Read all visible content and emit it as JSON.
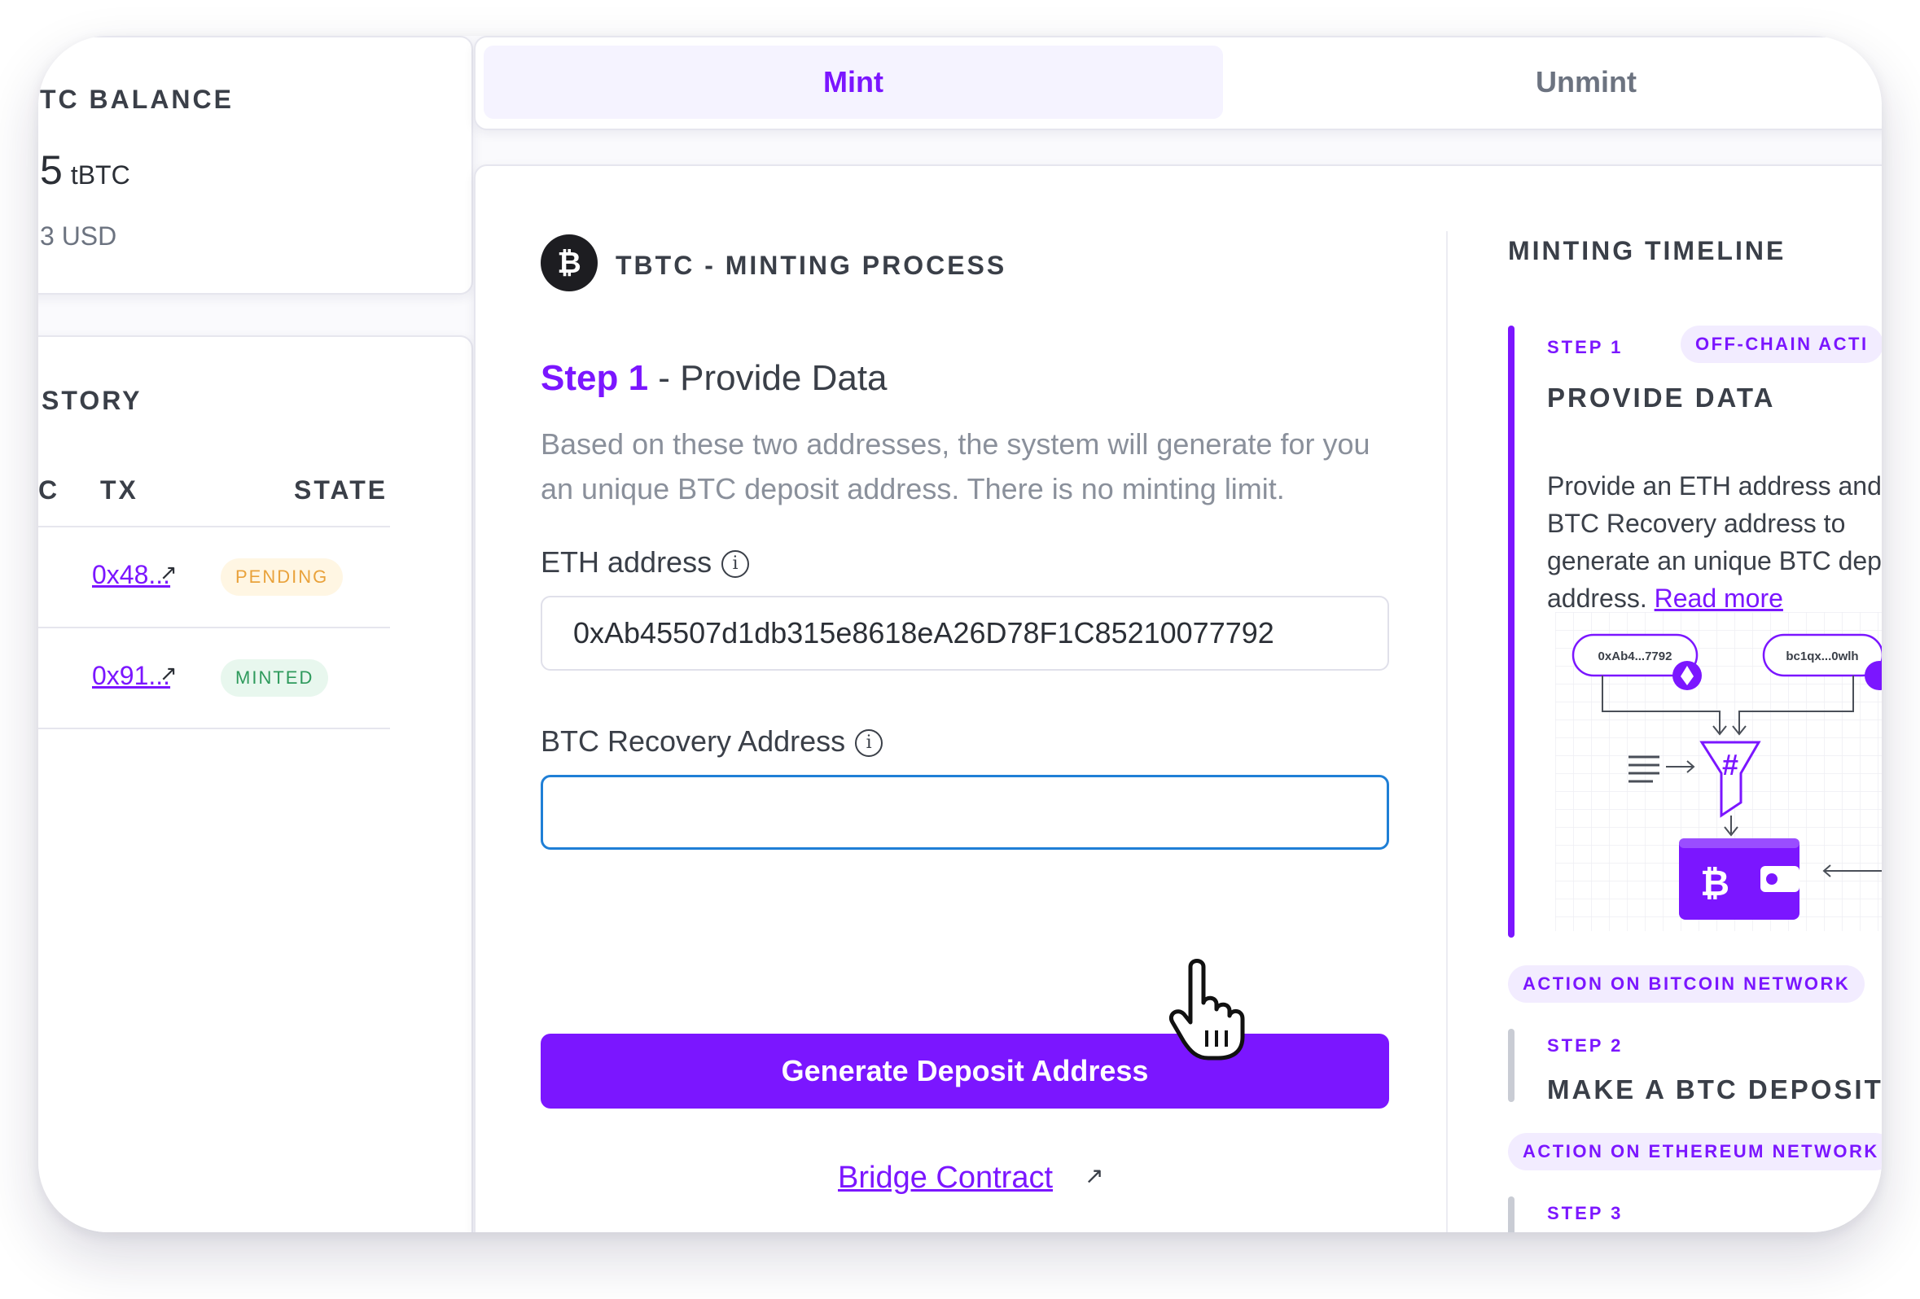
{
  "balance": {
    "title": "TC BALANCE",
    "amount": "5",
    "unit": "tBTC",
    "usd": "3 USD"
  },
  "history": {
    "title": "STORY",
    "columns": [
      "C",
      "TX",
      "STATE"
    ],
    "rows": [
      {
        "tx": "0x48...",
        "arrow": "↗",
        "state": "PENDING"
      },
      {
        "tx": "0x91...",
        "arrow": "↗",
        "state": "MINTED"
      }
    ]
  },
  "tabs": {
    "mint": "Mint",
    "unmint": "Unmint"
  },
  "process": {
    "logo": "₿",
    "title": "TBTC - MINTING PROCESS",
    "step_label": "Step 1",
    "step_title": "- Provide Data",
    "description": "Based on these two addresses, the system will generate for you an unique BTC deposit address. There is no minting limit.",
    "eth_label": "ETH address",
    "eth_value": "0xAb45507d1db315e8618eA26D78F1C85210077792",
    "btc_label": "BTC Recovery Address",
    "btc_value": "",
    "info_icon": "i",
    "button": "Generate Deposit Address",
    "bridge_link": "Bridge Contract",
    "bridge_arrow": "↗"
  },
  "timeline": {
    "title": "MINTING TIMELINE",
    "step1": {
      "label": "STEP 1",
      "pill": "OFF-CHAIN ACTI",
      "heading": "PROVIDE DATA",
      "text": "Provide an ETH address and BTC Recovery address to generate an unique BTC deposit address.",
      "link": "Read more"
    },
    "pill_bitcoin": "ACTION ON BITCOIN NETWORK",
    "step2": {
      "label": "STEP 2",
      "heading": "MAKE A BTC DEPOSIT"
    },
    "pill_ethereum": "ACTION ON ETHEREUM NETWORK",
    "step3": {
      "label": "STEP 3"
    },
    "illustration": {
      "eth_chip": "0xAb4...7792",
      "btc_chip": "bc1qx...0wlh",
      "hash": "#",
      "wallet": "₿"
    }
  },
  "colors": {
    "accent": "#7b16ff",
    "pending_text": "#e9a23b",
    "minted_text": "#2e9a5c",
    "focus_border": "#1f7fd6"
  }
}
